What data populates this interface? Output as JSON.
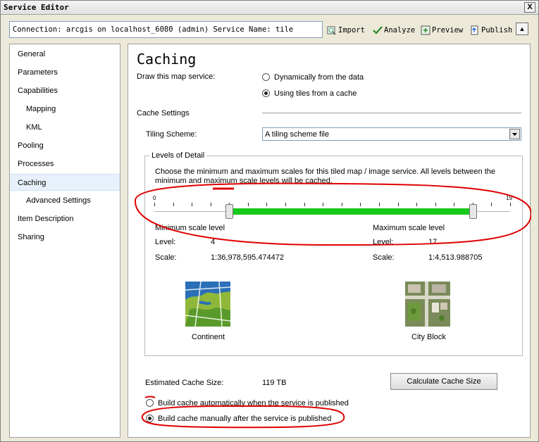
{
  "window": {
    "title": "Service Editor",
    "close_label": "X"
  },
  "toolbar": {
    "connection": "Connection: arcgis on localhost_6080 (admin)   Service Name: tile",
    "import_label": "Import",
    "analyze_label": "Analyze",
    "preview_label": "Preview",
    "publish_label": "Publish",
    "collapse_label": "▲"
  },
  "nav": {
    "items": [
      {
        "label": "General"
      },
      {
        "label": "Parameters"
      },
      {
        "label": "Capabilities"
      },
      {
        "label": "Mapping"
      },
      {
        "label": "KML"
      },
      {
        "label": "Pooling"
      },
      {
        "label": "Processes"
      },
      {
        "label": "Caching"
      },
      {
        "label": "Advanced Settings"
      },
      {
        "label": "Item Description"
      },
      {
        "label": "Sharing"
      }
    ],
    "selected": "Caching"
  },
  "caching": {
    "title": "Caching",
    "draw_label": "Draw this map service:",
    "opt_dynamic": "Dynamically from the data",
    "opt_tiles": "Using tiles from a cache",
    "cache_settings": "Cache Settings",
    "tiling_label": "Tiling Scheme:",
    "tiling_value": "A tiling scheme file",
    "lod_title": "Levels of Detail",
    "lod_desc": "Choose the minimum and maximum scales for this tiled map / image service. All levels between the minimum and maximum scale levels will be cached.",
    "slider": {
      "min": 0,
      "max": 19,
      "low": 4,
      "high": 17,
      "min_label": "0",
      "max_label": "19"
    },
    "min": {
      "heading": "Minimum scale level",
      "level_label": "Level:",
      "level": "4",
      "scale_label": "Scale:",
      "scale": "1:36,978,595.474472",
      "image_caption": "Continent"
    },
    "max": {
      "heading": "Maximum scale level",
      "level_label": "Level:",
      "level": "17",
      "scale_label": "Scale:",
      "scale": "1:4,513.988705",
      "image_caption": "City Block"
    },
    "est_label": "Estimated Cache Size:",
    "est_value": "119 TB",
    "calc_button": "Calculate Cache Size",
    "build_auto": "Build cache automatically when the service is published",
    "build_manual": "Build cache manually after the service is published"
  },
  "colors": {
    "accent_range": "#18c818",
    "annotation": "#e00000",
    "selected_nav": "#e8f1fb"
  }
}
